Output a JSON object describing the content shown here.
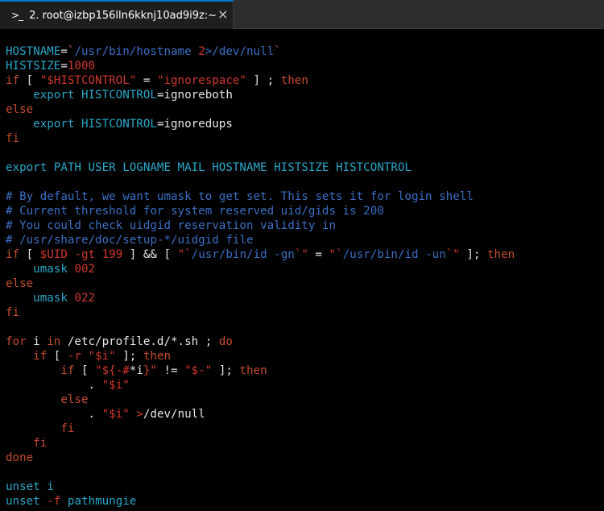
{
  "tab": {
    "icon": ">_",
    "title": "2. root@izbp156lln6kknj10ad9i9z:~",
    "close": "×"
  },
  "lines": [
    [
      [
        "v",
        "HOSTNAME"
      ],
      [
        "w",
        "="
      ],
      [
        "m",
        "`"
      ],
      [
        "c",
        "/usr/bin/hostname "
      ],
      [
        "s",
        "2"
      ],
      [
        "c",
        ">/dev/null"
      ],
      [
        "m",
        "`"
      ]
    ],
    [
      [
        "v",
        "HISTSIZE"
      ],
      [
        "w",
        "="
      ],
      [
        "s",
        "1000"
      ]
    ],
    [
      [
        "k",
        "if"
      ],
      [
        "w",
        " [ "
      ],
      [
        "s",
        "\"$HISTCONTROL\""
      ],
      [
        "w",
        " = "
      ],
      [
        "s",
        "\"ignorespace\""
      ],
      [
        "w",
        " ] ; "
      ],
      [
        "k",
        "then"
      ]
    ],
    [
      [
        "w",
        "    "
      ],
      [
        "v",
        "export"
      ],
      [
        "w",
        " "
      ],
      [
        "v",
        "HISTCONTROL"
      ],
      [
        "w",
        "=ignoreboth"
      ]
    ],
    [
      [
        "k",
        "else"
      ]
    ],
    [
      [
        "w",
        "    "
      ],
      [
        "v",
        "export"
      ],
      [
        "w",
        " "
      ],
      [
        "v",
        "HISTCONTROL"
      ],
      [
        "w",
        "=ignoredups"
      ]
    ],
    [
      [
        "k",
        "fi"
      ]
    ],
    [
      [
        "w",
        ""
      ]
    ],
    [
      [
        "v",
        "export"
      ],
      [
        "w",
        " "
      ],
      [
        "v",
        "PATH USER LOGNAME MAIL HOSTNAME HISTSIZE HISTCONTROL"
      ]
    ],
    [
      [
        "w",
        ""
      ]
    ],
    [
      [
        "c",
        "# By default, we want umask to get set. This sets it for login shell"
      ]
    ],
    [
      [
        "c",
        "# Current threshold for system reserved uid/gids is 200"
      ]
    ],
    [
      [
        "c",
        "# You could check uidgid reservation validity in"
      ]
    ],
    [
      [
        "c",
        "# /usr/share/doc/setup-*/uidgid file"
      ]
    ],
    [
      [
        "k",
        "if"
      ],
      [
        "w",
        " [ "
      ],
      [
        "s",
        "$UID"
      ],
      [
        "w",
        " "
      ],
      [
        "s",
        "-gt"
      ],
      [
        "w",
        " "
      ],
      [
        "s",
        "199"
      ],
      [
        "w",
        " ] && [ "
      ],
      [
        "s",
        "\"`"
      ],
      [
        "c",
        "/usr/bin/id -gn"
      ],
      [
        "s",
        "`\""
      ],
      [
        "w",
        " = "
      ],
      [
        "s",
        "\"`"
      ],
      [
        "c",
        "/usr/bin/id -un"
      ],
      [
        "s",
        "`\""
      ],
      [
        "w",
        " ]; "
      ],
      [
        "k",
        "then"
      ]
    ],
    [
      [
        "w",
        "    "
      ],
      [
        "v",
        "umask"
      ],
      [
        "w",
        " "
      ],
      [
        "s",
        "002"
      ]
    ],
    [
      [
        "k",
        "else"
      ]
    ],
    [
      [
        "w",
        "    "
      ],
      [
        "v",
        "umask"
      ],
      [
        "w",
        " "
      ],
      [
        "s",
        "022"
      ]
    ],
    [
      [
        "k",
        "fi"
      ]
    ],
    [
      [
        "w",
        ""
      ]
    ],
    [
      [
        "k",
        "for"
      ],
      [
        "w",
        " i "
      ],
      [
        "k",
        "in"
      ],
      [
        "w",
        " /etc/profile.d/*.sh ; "
      ],
      [
        "k",
        "do"
      ]
    ],
    [
      [
        "w",
        "    "
      ],
      [
        "k",
        "if"
      ],
      [
        "w",
        " [ "
      ],
      [
        "s",
        "-r"
      ],
      [
        "w",
        " "
      ],
      [
        "s",
        "\"$i\""
      ],
      [
        "w",
        " ]; "
      ],
      [
        "k",
        "then"
      ]
    ],
    [
      [
        "w",
        "        "
      ],
      [
        "k",
        "if"
      ],
      [
        "w",
        " [ "
      ],
      [
        "s",
        "\"${-#"
      ],
      [
        "w",
        "*i"
      ],
      [
        "s",
        "}\""
      ],
      [
        "w",
        " != "
      ],
      [
        "s",
        "\"$-\""
      ],
      [
        "w",
        " ]; "
      ],
      [
        "k",
        "then"
      ]
    ],
    [
      [
        "w",
        "            . "
      ],
      [
        "s",
        "\"$i\""
      ]
    ],
    [
      [
        "w",
        "        "
      ],
      [
        "k",
        "else"
      ]
    ],
    [
      [
        "w",
        "            . "
      ],
      [
        "s",
        "\"$i\""
      ],
      [
        "w",
        " "
      ],
      [
        "s",
        ">"
      ],
      [
        "w",
        "/dev/null"
      ]
    ],
    [
      [
        "w",
        "        "
      ],
      [
        "k",
        "fi"
      ]
    ],
    [
      [
        "w",
        "    "
      ],
      [
        "k",
        "fi"
      ]
    ],
    [
      [
        "k",
        "done"
      ]
    ],
    [
      [
        "w",
        ""
      ]
    ],
    [
      [
        "v",
        "unset"
      ],
      [
        "w",
        " "
      ],
      [
        "v",
        "i"
      ]
    ],
    [
      [
        "v",
        "unset"
      ],
      [
        "w",
        " "
      ],
      [
        "s",
        "-f"
      ],
      [
        "w",
        " "
      ],
      [
        "v",
        "pathmungie"
      ]
    ]
  ]
}
